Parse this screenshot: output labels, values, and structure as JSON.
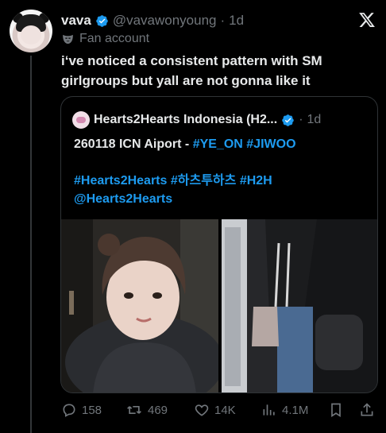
{
  "author": {
    "name": "vava",
    "handle": "@vavawonyoung",
    "separator": "·",
    "time": "1d",
    "label": "Fan account"
  },
  "tweet": {
    "text": "i‘ve noticed a consistent pattern with SM girlgroups but yall are not gonna like it"
  },
  "quote": {
    "name": "Hearts2Hearts Indonesia (H2...",
    "separator": "·",
    "time": "1d",
    "line1_plain": "260118 ICN Aiport - ",
    "line1_tags": [
      "#YE_ON",
      "#JIWOO"
    ],
    "line2_tags": [
      "#Hearts2Hearts",
      "#하츠투하츠",
      "#H2H"
    ],
    "mention": "@Hearts2Hearts"
  },
  "actions": {
    "replies": "158",
    "reposts": "469",
    "likes": "14K",
    "views": "4.1M"
  },
  "colors": {
    "background": "#000000",
    "accent": "#1d9bf0",
    "muted": "#71767b",
    "text": "#e7e9ea"
  },
  "icons": [
    "x-logo-icon",
    "verified-badge-icon",
    "mask-icon",
    "reply-icon",
    "repost-icon",
    "like-icon",
    "views-icon",
    "bookmark-icon",
    "share-icon"
  ]
}
